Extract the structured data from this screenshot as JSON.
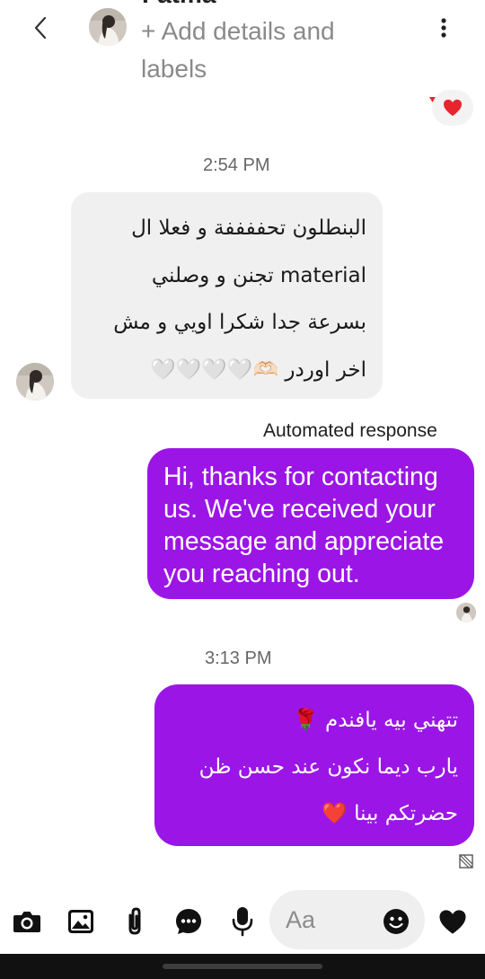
{
  "header": {
    "name_cut": "Fatma",
    "add_details": "+ Add details and labels"
  },
  "conversation": {
    "time_1": "2:54 PM",
    "incoming_lines": [
      "البنطلون تحففففة و فعلا ال",
      "material تجنن و وصلني",
      "بسرعة جدا شكرا اويي و مش",
      "اخر اوردر 🫶🏻🤍🤍🤍🤍"
    ],
    "automated_label": "Automated response",
    "automated_reply": "Hi, thanks for contacting us. We've received your message and appreciate you reaching out.",
    "time_2": "3:13 PM",
    "outgoing_lines": [
      "تتهني بيه يافندم 🌹",
      "يارب ديما نكون عند حسن ظن",
      "حضرتكم بينا ❤️"
    ]
  },
  "composer": {
    "placeholder": "Aa"
  },
  "colors": {
    "accent": "#9b16e6",
    "incoming_bubble": "#f0f0f0",
    "composer_bg": "#efefef",
    "heart": "#e8252f"
  },
  "icons": [
    "back-arrow-icon",
    "kebab-menu-icon",
    "camera-icon",
    "gallery-icon",
    "attachment-icon",
    "more-chat-icon",
    "microphone-icon",
    "emoji-icon",
    "heart-icon",
    "seen-icon"
  ]
}
